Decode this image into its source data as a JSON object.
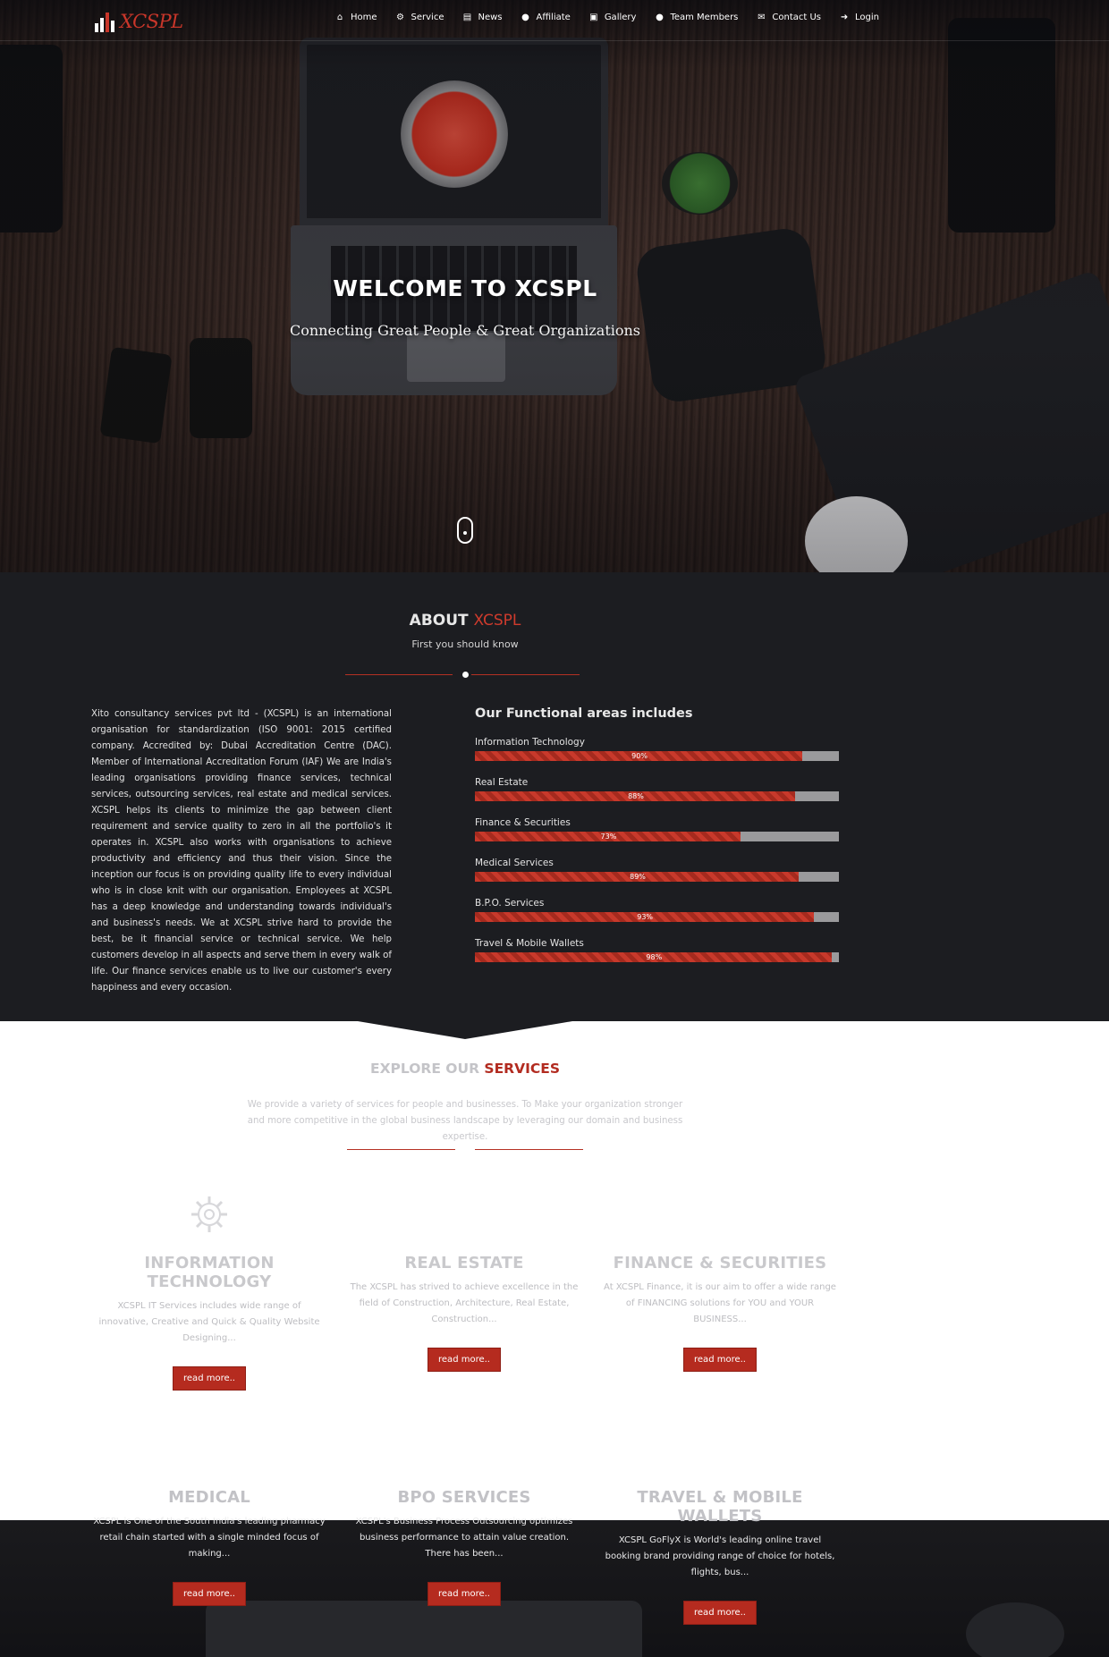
{
  "brand": {
    "name": "XCSPL"
  },
  "nav": {
    "items": [
      {
        "label": "Home",
        "icon": "home-icon",
        "glyph": "⌂"
      },
      {
        "label": "Service",
        "icon": "gear-icon",
        "glyph": "⚙"
      },
      {
        "label": "News",
        "icon": "newspaper-icon",
        "glyph": "▤"
      },
      {
        "label": "Affiliate",
        "icon": "user-icon",
        "glyph": "●"
      },
      {
        "label": "Gallery",
        "icon": "image-icon",
        "glyph": "▣"
      },
      {
        "label": "Team Members",
        "icon": "users-icon",
        "glyph": "●"
      },
      {
        "label": "Contact Us",
        "icon": "envelope-icon",
        "glyph": "✉"
      },
      {
        "label": "Login",
        "icon": "sign-in-icon",
        "glyph": "➜"
      }
    ]
  },
  "hero": {
    "title": "WELCOME TO XCSPL",
    "subtitle": "Connecting Great People & Great Organizations"
  },
  "about": {
    "title_prefix": "ABOUT",
    "title_accent": "XCSPL",
    "subtitle": "First you should know",
    "body": "Xito consultancy services pvt ltd - (XCSPL) is an international organisation for standardization (ISO 9001: 2015 certified company. Accredited by: Dubai Accreditation Centre (DAC). Member of International Accreditation Forum (IAF) We are India's leading organisations providing finance services, technical services, outsourcing services, real estate and medical services. XCSPL helps its clients to minimize the gap between client requirement and service quality to zero in all the portfolio's it operates in. XCSPL also works with organisations to achieve productivity and efficiency and thus their vision. Since the inception our focus is on providing quality life to every individual who is in close knit with our organisation. Employees at XCSPL has a deep knowledge and understanding towards individual's and business's needs. We at XCSPL strive hard to provide the best, be it financial service or technical service. We help customers develop in all aspects and serve them in every walk of life. Our finance services enable us to live our customer's every happiness and every occasion.",
    "areas_title": "Our Functional areas includes",
    "areas": [
      {
        "label": "Information Technology",
        "percent_label": "90%",
        "value": 90
      },
      {
        "label": "Real Estate",
        "percent_label": "88%",
        "value": 88
      },
      {
        "label": "Finance & Securities",
        "percent_label": "73%",
        "value": 73
      },
      {
        "label": "Medical Services",
        "percent_label": "89%",
        "value": 89
      },
      {
        "label": "B.P.O. Services",
        "percent_label": "93%",
        "value": 93
      },
      {
        "label": "Travel & Mobile Wallets",
        "percent_label": "98%",
        "value": 98
      }
    ]
  },
  "services": {
    "title_prefix": "EXPLORE OUR",
    "title_accent": "SERVICES",
    "description": "We provide a variety of services for people and businesses. To Make your organization stronger and more competitive in the global business landscape by leveraging our domain and business expertise.",
    "cards": [
      {
        "title": "INFORMATION TECHNOLOGY",
        "text": "XCSPL IT Services includes wide range of innovative, Creative and Quick & Quality Website Designing...",
        "button": "read more.."
      },
      {
        "title": "REAL ESTATE",
        "text": "The XCSPL has strived to achieve excellence in the field of Construction, Architecture, Real Estate, Construction...",
        "button": "read more.."
      },
      {
        "title": "FINANCE & SECURITIES",
        "text": "At XCSPL Finance, it is our aim to offer a wide range of FINANCING solutions for YOU and YOUR BUSINESS...",
        "button": "read more.."
      },
      {
        "title": "MEDICAL",
        "text": "XCSPL is One of the South India's leading pharmacy retail chain started with a single minded focus of making...",
        "button": "read more.."
      },
      {
        "title": "BPO SERVICES",
        "text": "XCSPL's Business Process Outsourcing optimizes business performance to attain value creation. There has been...",
        "button": "read more.."
      },
      {
        "title": "TRAVEL & MOBILE WALLETS",
        "text": "XCSPL GoFlyX is World's leading online travel booking brand providing range of choice for hotels, flights, bus...",
        "button": "read more.."
      }
    ]
  },
  "colors": {
    "accent": "#c8392b",
    "dark": "#1c1d21"
  }
}
